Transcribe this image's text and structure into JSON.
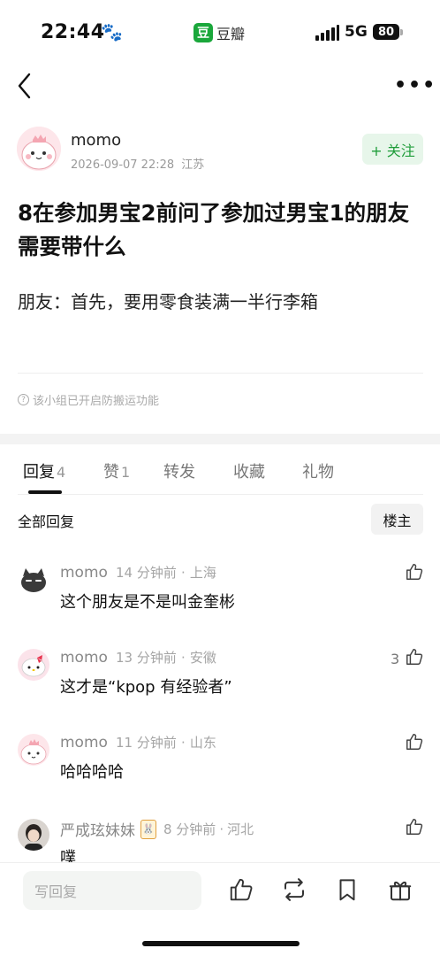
{
  "status_bar": {
    "time": "22:44",
    "app_name": "豆瓣",
    "app_logo_char": "豆",
    "network": "5G",
    "battery": "80"
  },
  "post": {
    "author": "momo",
    "date": "2026-09-07 22:28",
    "location": "江苏",
    "follow_label": "+ 关注",
    "title": "8在参加男宝2前问了参加过男宝1的朋友需要带什么",
    "body": "朋友：首先，要用零食装满一半行李箱",
    "notice": "该小组已开启防搬运功能"
  },
  "tabs": [
    {
      "label": "回复",
      "count": "4"
    },
    {
      "label": "赞",
      "count": "1"
    },
    {
      "label": "转发",
      "count": ""
    },
    {
      "label": "收藏",
      "count": ""
    },
    {
      "label": "礼物",
      "count": ""
    }
  ],
  "replies_header": {
    "all_label": "全部回复",
    "filter_label": "楼主"
  },
  "comments": [
    {
      "name": "momo",
      "time": "14 分钟前",
      "location": "上海",
      "text": "这个朋友是不是叫金奎彬",
      "likes": ""
    },
    {
      "name": "momo",
      "time": "13 分钟前",
      "location": "安徽",
      "text": "这才是“kpop 有经验者”",
      "likes": "3"
    },
    {
      "name": "momo",
      "time": "11 分钟前",
      "location": "山东",
      "text": "哈哈哈哈",
      "likes": ""
    },
    {
      "name": "严成玹妹妹",
      "time": "8 分钟前",
      "location": "河北",
      "text": "噗",
      "likes": ""
    }
  ],
  "bottom_bar": {
    "reply_placeholder": "写回复"
  },
  "colors": {
    "accent_green": "#1f9d3a",
    "follow_bg": "#e7f6ea"
  }
}
